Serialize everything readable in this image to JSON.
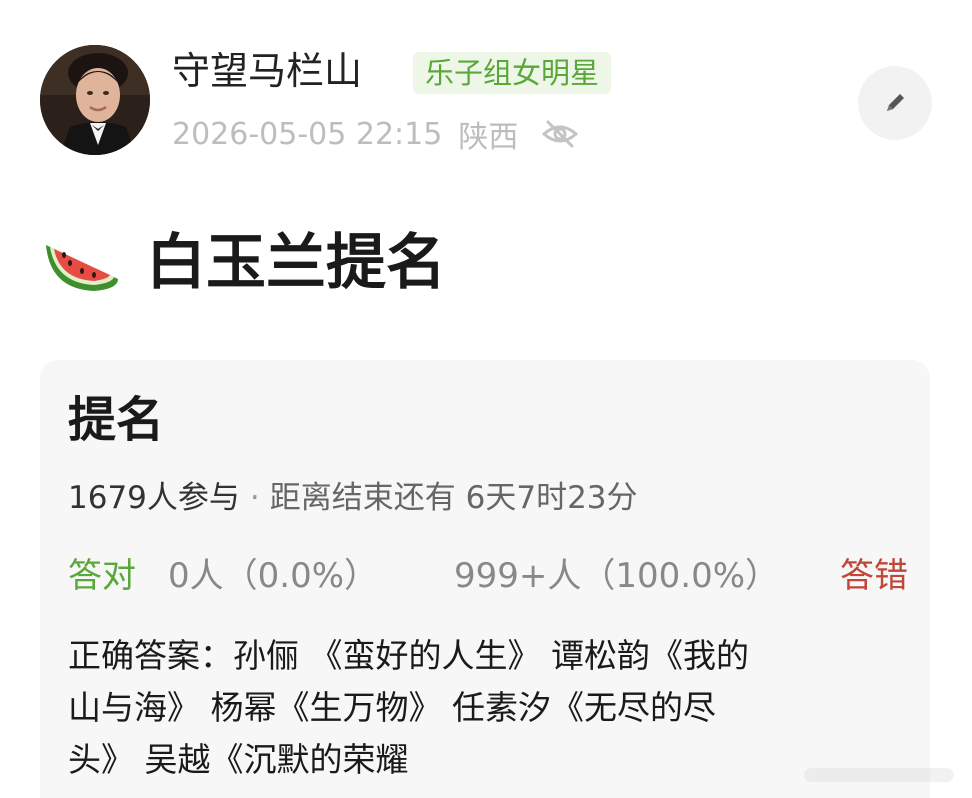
{
  "header": {
    "username": "守望马栏山",
    "badge": "乐子组女明星",
    "timestamp": "2026-05-05 22:15",
    "location": "陕西"
  },
  "post": {
    "title": "白玉兰提名",
    "emoji": "watermelon-icon"
  },
  "quiz": {
    "title": "提名",
    "participants": "1679人参与",
    "separator": "·",
    "remaining": "距离结束还有 6天7时23分",
    "correct_label": "答对",
    "correct_count": "0人（0.0%）",
    "wrong_count": "999+人（100.0%）",
    "wrong_label": "答错",
    "answer_lines": [
      "正确答案：孙俪 《蛮好的人生》 谭松韵《我的",
      "山与海》 杨幂《生万物》 任素汐《无尽的尽",
      "头》 吴越《沉默的荣耀"
    ]
  },
  "colors": {
    "correct": "#5aa83a",
    "wrong": "#c0463a",
    "badge_bg": "#eef7e7",
    "meta_text": "#bdbdbd",
    "card_bg": "#f7f7f7"
  },
  "icons": {
    "visibility": "eye-off-icon",
    "edit": "pencil-icon"
  }
}
